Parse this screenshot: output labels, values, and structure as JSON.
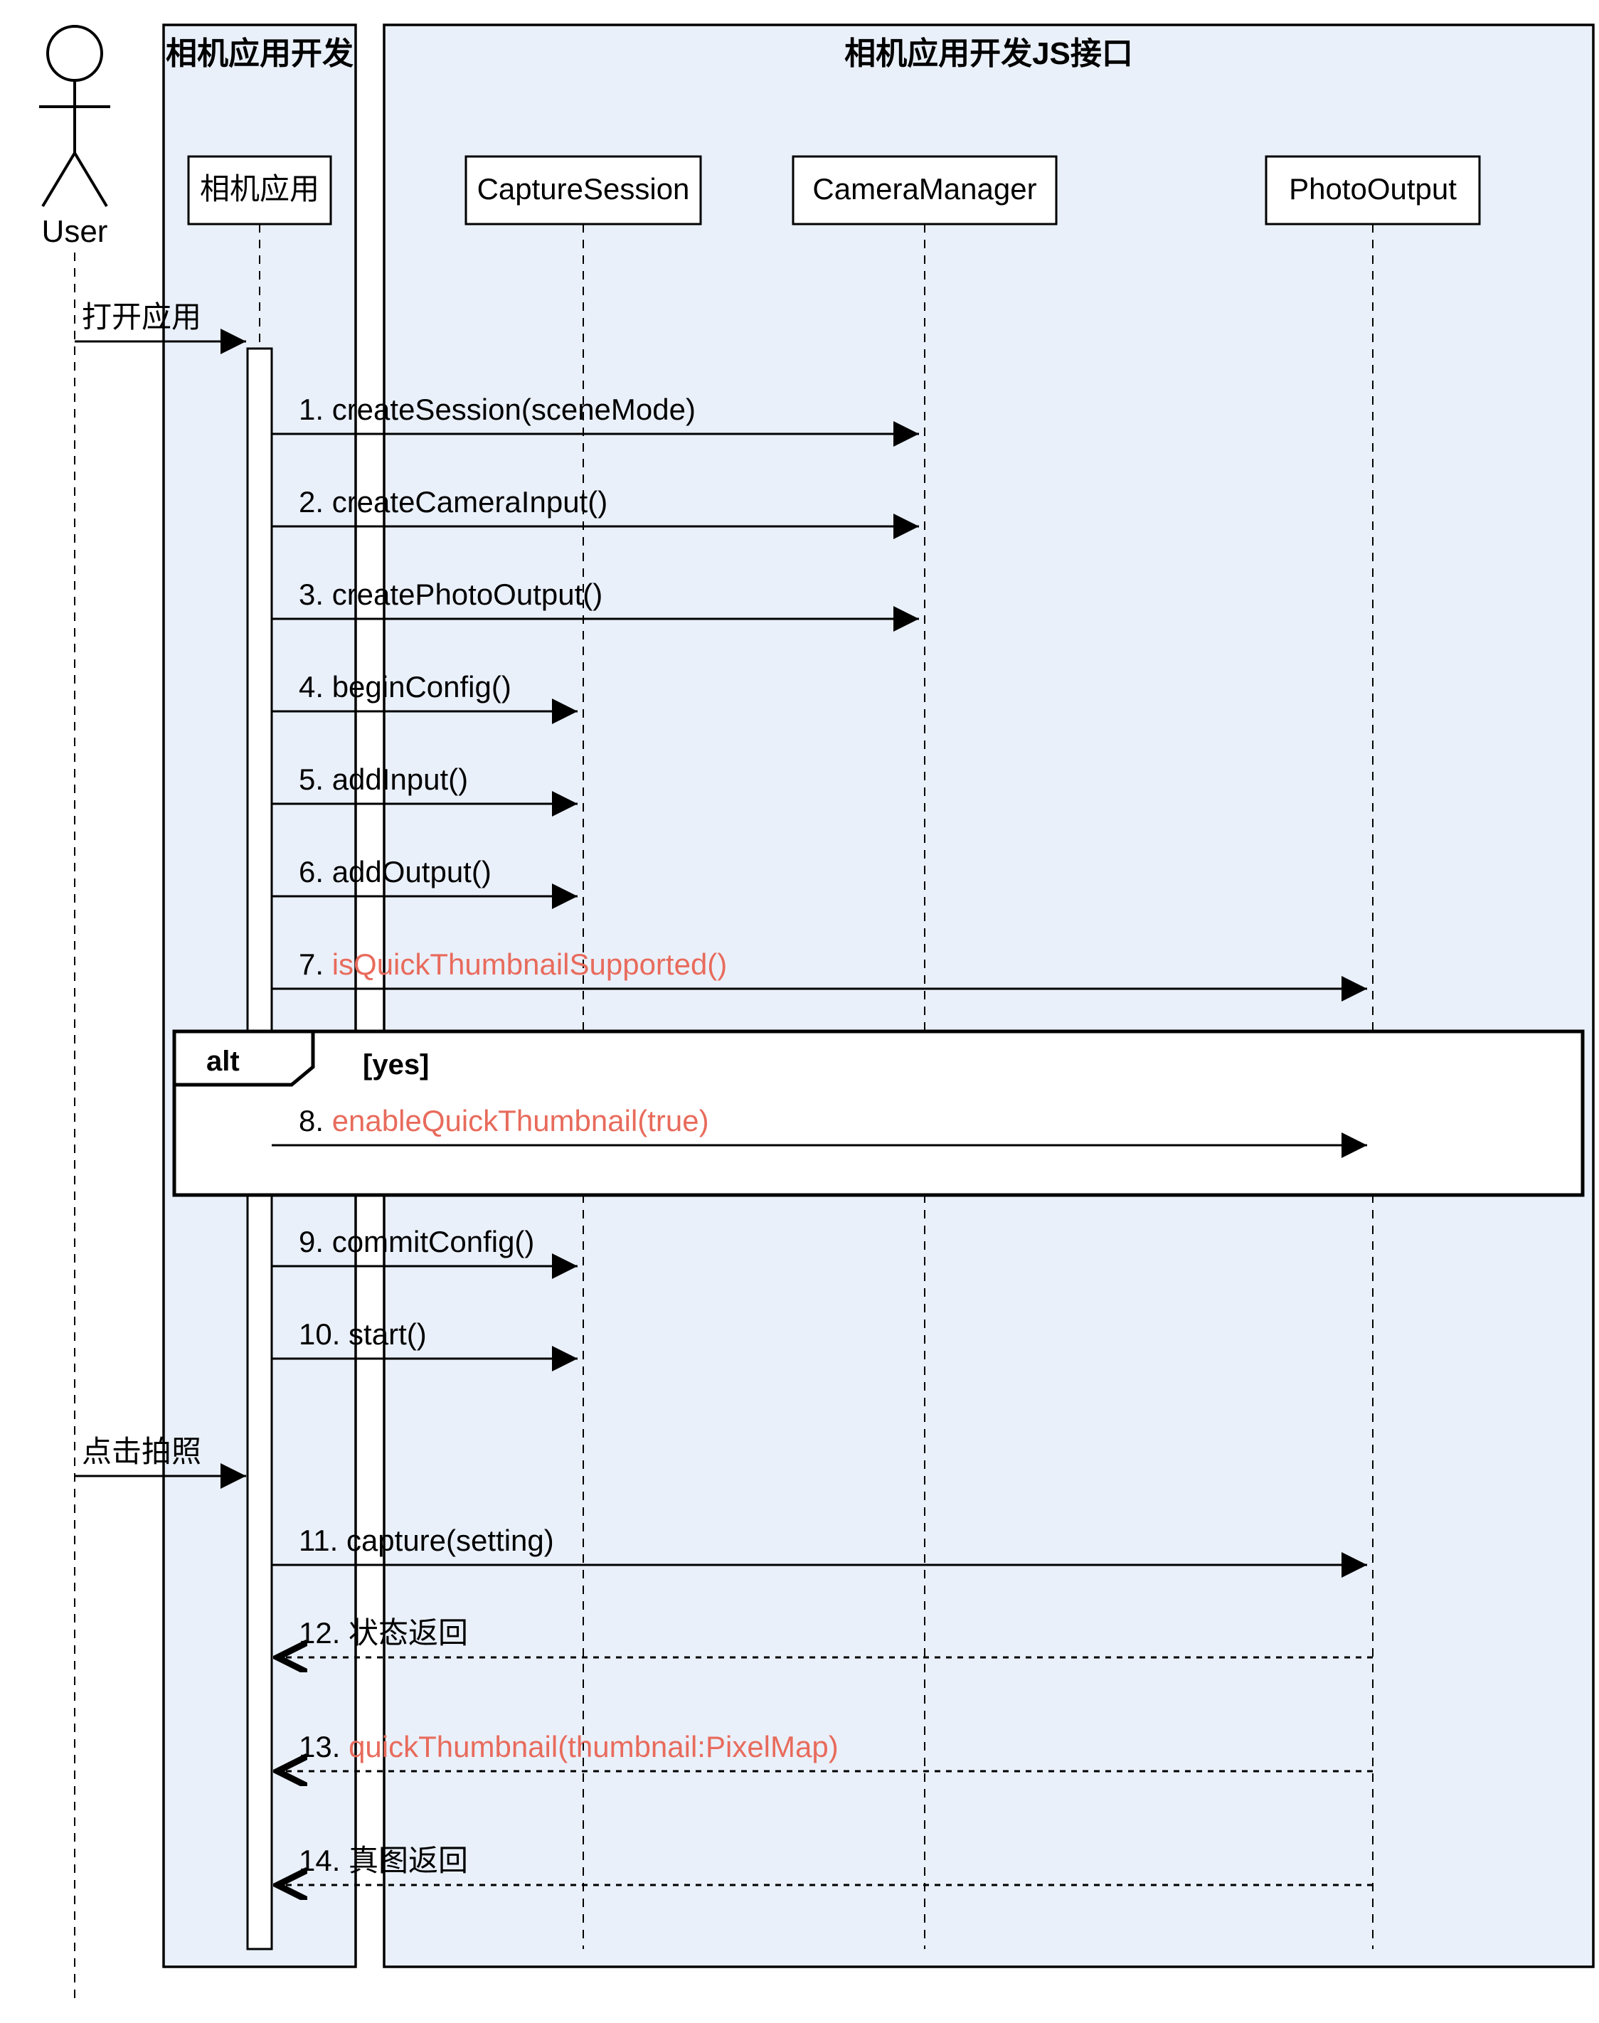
{
  "actor": "User",
  "groups": {
    "left": "相机应用开发",
    "right": "相机应用开发JS接口"
  },
  "participants": {
    "app": "相机应用",
    "session": "CaptureSession",
    "manager": "CameraManager",
    "output": "PhotoOutput"
  },
  "user_actions": {
    "open": "打开应用",
    "click": "点击拍照"
  },
  "messages": {
    "m1": "1. createSession(sceneMode)",
    "m2": "2. createCameraInput()",
    "m3": "3. createPhotoOutput()",
    "m4": "4. beginConfig()",
    "m5": "5. addInput()",
    "m6": "6. addOutput()",
    "m7a": "7. ",
    "m7b": "isQuickThumbnailSupported()",
    "m8a": "8. ",
    "m8b": "enableQuickThumbnail(true)",
    "m9": "9. commitConfig()",
    "m10": "10. start()",
    "m11": "11. capture(setting)",
    "m12": "12. 状态返回",
    "m13a": "13. ",
    "m13b": "quickThumbnail(thumbnail:PixelMap)",
    "m14": "14. 真图返回"
  },
  "alt": {
    "keyword": "alt",
    "cond": "[yes]"
  }
}
